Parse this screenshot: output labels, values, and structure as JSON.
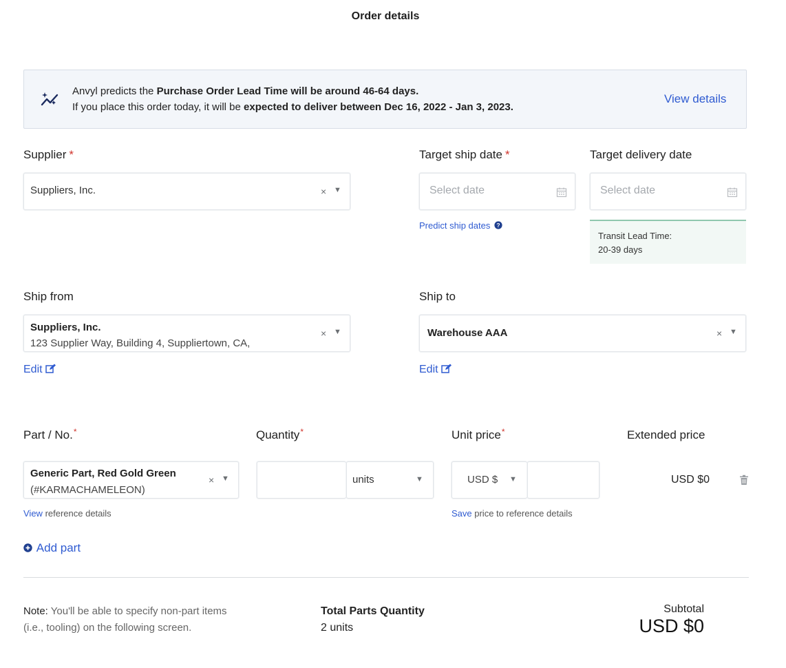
{
  "page": {
    "title": "Order details"
  },
  "banner": {
    "line1_prefix": "Anvyl predicts the ",
    "line1_bold": "Purchase Order Lead Time will be around 46-64 days.",
    "line2_prefix": "If you place this order today, it will be ",
    "line2_bold": "expected to deliver between Dec 16, 2022 - Jan 3, 2023.",
    "link": "View details",
    "icon": "sparkle-trend-icon"
  },
  "supplier": {
    "label": "Supplier",
    "required_mark": "*",
    "value": "Suppliers, Inc."
  },
  "target_ship": {
    "label": "Target ship date",
    "required_mark": "*",
    "placeholder": "Select date",
    "predict_link": "Predict ship dates"
  },
  "target_delivery": {
    "label": "Target delivery date",
    "placeholder": "Select date",
    "transit_line1": "Transit Lead Time:",
    "transit_line2": "20-39 days"
  },
  "ship_from": {
    "label": "Ship from",
    "name": "Suppliers, Inc.",
    "address": "123 Supplier Way, Building 4, Suppliertown, CA,",
    "edit": "Edit"
  },
  "ship_to": {
    "label": "Ship to",
    "name": "Warehouse AAA",
    "edit": "Edit"
  },
  "parts": {
    "col_part": "Part / No.",
    "col_qty": "Quantity",
    "col_unit_price": "Unit price",
    "col_extended": "Extended price",
    "required_mark": "*",
    "row": {
      "part_name": "Generic Part, Red Gold Green",
      "part_number": "(#KARMACHAMELEON)",
      "quantity": "",
      "unit": "units",
      "currency": "USD $",
      "price": "",
      "extended": "USD $0"
    },
    "view_link": "View",
    "view_rest": " reference details",
    "save_link": "Save",
    "save_rest": " price to reference details",
    "add_part": "Add part"
  },
  "footer": {
    "note_prefix": "Note:",
    "note_rest": " You'll be able to specify non-part items",
    "note_line2": "(i.e., tooling) on the following screen.",
    "total_label": "Total Parts Quantity",
    "total_value": "2 units",
    "subtotal_label": "Subtotal",
    "subtotal_value": "USD $0"
  },
  "colors": {
    "link": "#2f5bd1",
    "required": "#d0342c",
    "banner_bg": "#f3f6fa",
    "transit_bg": "#f2f8f5",
    "transit_border": "#8fc7ae"
  }
}
